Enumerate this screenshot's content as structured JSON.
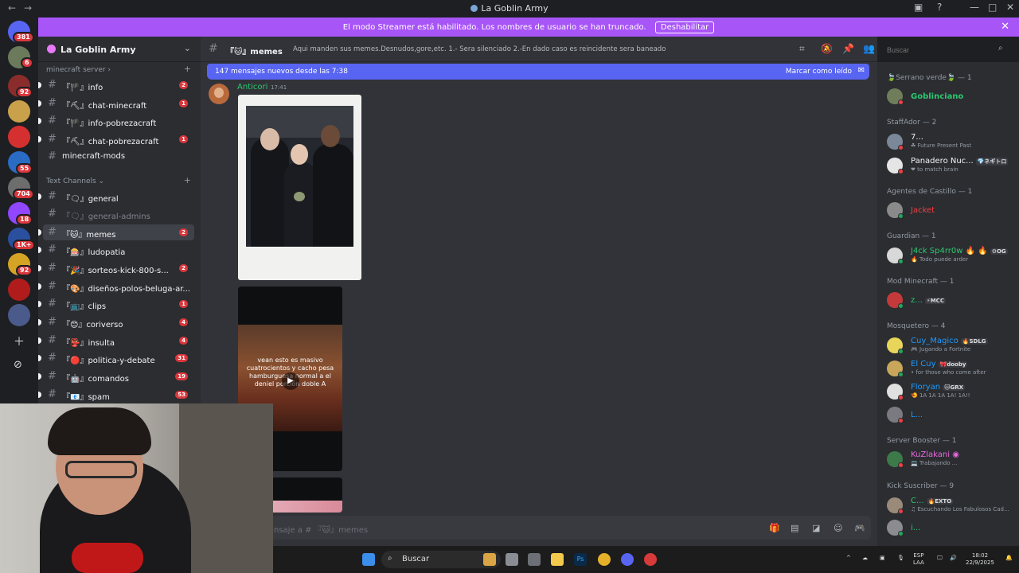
{
  "window": {
    "title": "La Goblin Army"
  },
  "banner": {
    "text": "El modo Streamer está habilitado. Los nombres de usuario se han truncado.",
    "button": "Deshabilitar"
  },
  "server_rail": {
    "badges": [
      "381",
      "6",
      "92",
      "55",
      "704",
      "18",
      "1K+",
      "92"
    ]
  },
  "sidebar": {
    "server_name": "La Goblin Army",
    "categories": [
      {
        "name": "minecraft server ›"
      },
      {
        "name": "Text Channels ⌄"
      }
    ],
    "channels": [
      {
        "label": "『🏴』info",
        "count": "2"
      },
      {
        "label": "『⛏』chat-minecraft",
        "count": "1"
      },
      {
        "label": "『🏴』info-pobrezacraft",
        "count": ""
      },
      {
        "label": "『⛏』chat-pobrezacraft",
        "count": "1"
      },
      {
        "label": "minecraft-mods",
        "count": ""
      },
      {
        "label": "『🗨』general",
        "count": ""
      },
      {
        "label": "『🗨』general-admins",
        "count": ""
      },
      {
        "label": "『🐱』memes",
        "count": "2"
      },
      {
        "label": "『🎰』ludopatia",
        "count": ""
      },
      {
        "label": "『🎉』sorteos-kick-800-s...",
        "count": "2"
      },
      {
        "label": "『🎨』diseños-polos-beluga-ar...",
        "count": ""
      },
      {
        "label": "『📺』clips",
        "count": "1"
      },
      {
        "label": "『😊』coriverso",
        "count": "4"
      },
      {
        "label": "『👺』insulta",
        "count": "4"
      },
      {
        "label": "『🔴』politica-y-debate",
        "count": "31"
      },
      {
        "label": "『🤖』comandos",
        "count": "19"
      },
      {
        "label": "『📧』spam",
        "count": "53"
      }
    ]
  },
  "chat": {
    "channel_name": "『🐱』memes",
    "topic": "Aqui manden sus memes.Desnudos,gore,etc. 1.- Sera silenciado 2.-En dado caso es reincidente sera baneado",
    "search_placeholder": "Buscar",
    "new_messages": "147 mensajes nuevos desde las 7:38",
    "mark_read": "Marcar como leído",
    "message": {
      "author": "Anticori",
      "time": "17:41"
    },
    "video_caption": "vean esto es masivo cuatrocientos y cacho pesa hamburguesa normal a el deniel porción doble A",
    "composer_placeholder": "nsaje a # 『🐱』memes"
  },
  "members": {
    "groups": [
      {
        "title": "🍃Serrano verde🍃 — 1",
        "members": [
          {
            "name": "Goblinciano",
            "sub": "",
            "tag": "",
            "color": "#2dc770"
          }
        ]
      },
      {
        "title": "StaffAdor — 2",
        "members": [
          {
            "name": "7...",
            "sub": "☘ Future Present Past",
            "tag": "",
            "color": "#f2f3f5"
          },
          {
            "name": "Panadero Nuc...",
            "sub": "❤ to match brain",
            "tag": "💎ネギトロ",
            "color": "#f2f3f5"
          }
        ]
      },
      {
        "title": "Agentes de Castillo — 1",
        "members": [
          {
            "name": "Jacket",
            "sub": "",
            "tag": "",
            "color": "#f23f43"
          }
        ]
      },
      {
        "title": "Guardian — 1",
        "members": [
          {
            "name": "J4ck Sp4rr0w 🔥 🔥",
            "sub": "🔥 Todo puede arder",
            "tag": "⚙OG",
            "color": "#2dc770"
          }
        ]
      },
      {
        "title": "Mod Minecraft — 1",
        "members": [
          {
            "name": "z...",
            "sub": "",
            "tag": "⚡MCC",
            "color": "#2dc770"
          }
        ]
      },
      {
        "title": "Mosquetero — 4",
        "members": [
          {
            "name": "Cuy_Magico",
            "sub": "🎮 Jugando a Fortnite",
            "tag": "🔥SDLG",
            "color": "#1e9bff"
          },
          {
            "name": "El Cuy",
            "sub": "• for those who come after",
            "tag": "🎀dooby",
            "color": "#1e9bff"
          },
          {
            "name": "Floryan",
            "sub": "🍤 1A 1A 1A 1A! 1A!!",
            "tag": "🐱GRX",
            "color": "#1e9bff"
          },
          {
            "name": "L...",
            "sub": "",
            "tag": "",
            "color": "#1e9bff"
          }
        ]
      },
      {
        "title": "Server Booster — 1",
        "members": [
          {
            "name": "KuZlakani ◉",
            "sub": "💻 Trabajando ...",
            "tag": "",
            "color": "#ea68e0"
          }
        ]
      },
      {
        "title": "Kick Suscriber — 9",
        "members": [
          {
            "name": "C...",
            "sub": "♫ Escuchando Los Fabulosos Cad...",
            "tag": "🔥EXTO",
            "color": "#2dc770"
          },
          {
            "name": "i...",
            "sub": "",
            "tag": "",
            "color": "#2dc770"
          }
        ]
      }
    ]
  },
  "taskbar": {
    "search": "Buscar",
    "lang": "ESP",
    "lang2": "LAA",
    "time": "18:02",
    "date": "22/9/2025"
  },
  "colors": {
    "accent": "#5865f2",
    "banner": "#a855f7",
    "mention": "#da373c"
  }
}
